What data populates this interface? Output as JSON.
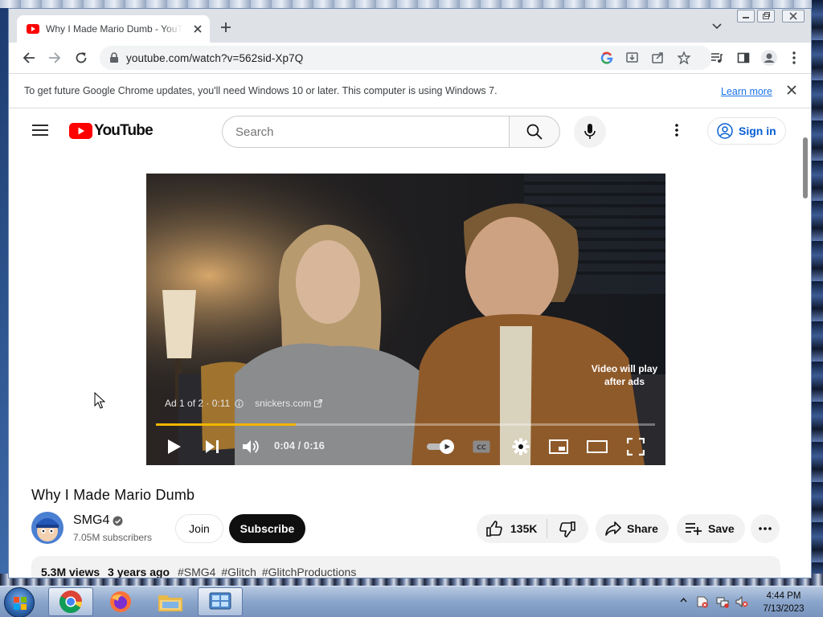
{
  "browser": {
    "tab_title": "Why I Made Mario Dumb - YouTube",
    "url": "youtube.com/watch?v=562sid-Xp7Q",
    "infobar_text": "To get future Google Chrome updates, you'll need Windows 10 or later. This computer is using Windows 7.",
    "infobar_link": "Learn more"
  },
  "youtube": {
    "logo_text": "YouTube",
    "search_placeholder": "Search",
    "signin_label": "Sign in",
    "player": {
      "ad_label": "Ad 1 of 2 · 0:11",
      "ad_domain": "snickers.com",
      "video_note": "Video will play after ads",
      "time": "0:04 / 0:16",
      "progress_fraction": 0.28
    },
    "video_title": "Why I Made Mario Dumb",
    "channel": {
      "name": "SMG4",
      "subscribers": "7.05M subscribers"
    },
    "actions": {
      "join": "Join",
      "subscribe": "Subscribe",
      "likes": "135K",
      "share": "Share",
      "save": "Save"
    },
    "description": {
      "views": "5.3M views",
      "age": "3 years ago",
      "tags": [
        "#SMG4",
        "#Glitch",
        "#GlitchProductions"
      ]
    }
  },
  "taskbar": {
    "clock_time": "4:44 PM",
    "clock_date": "7/13/2023"
  },
  "colors": {
    "youtube_red": "#ff0000",
    "link_blue": "#065fd4",
    "ad_progress": "#f2b600"
  }
}
